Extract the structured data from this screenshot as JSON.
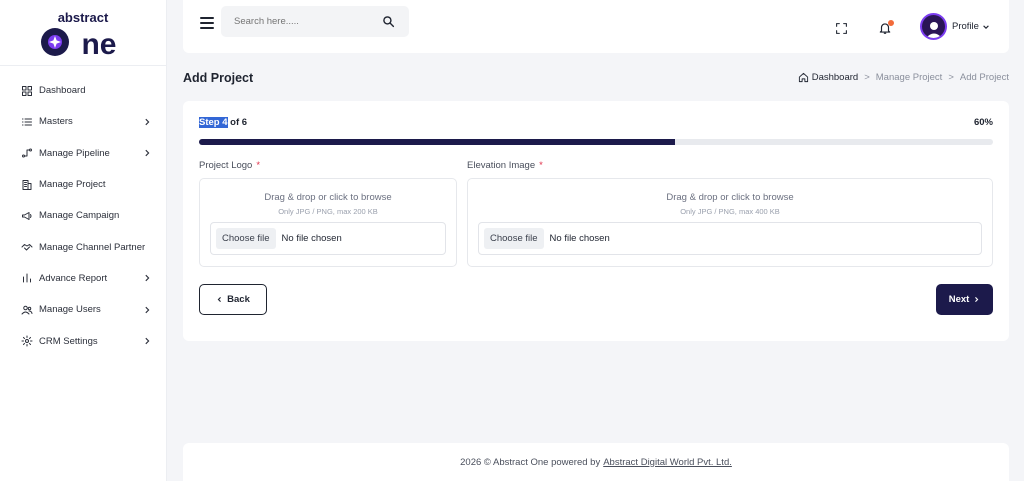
{
  "brand": {
    "logo_top": "abstract",
    "logo_bottom": "one",
    "colors": {
      "primary": "#1c1a4b",
      "accent_purple": "#7b3cf0",
      "notification": "#f26b3a",
      "required": "#e0314b"
    }
  },
  "header": {
    "search_placeholder": "Search here.....",
    "profile_label": "Profile"
  },
  "sidebar": {
    "items": [
      {
        "label": "Dashboard",
        "icon": "grid-icon",
        "has_submenu": false
      },
      {
        "label": "Masters",
        "icon": "list-icon",
        "has_submenu": true
      },
      {
        "label": "Manage Pipeline",
        "icon": "pipeline-icon",
        "has_submenu": true
      },
      {
        "label": "Manage Project",
        "icon": "building-icon",
        "has_submenu": false
      },
      {
        "label": "Manage Campaign",
        "icon": "megaphone-icon",
        "has_submenu": false
      },
      {
        "label": "Manage Channel Partner",
        "icon": "handshake-icon",
        "has_submenu": false
      },
      {
        "label": "Advance Report",
        "icon": "bar-chart-icon",
        "has_submenu": true
      },
      {
        "label": "Manage Users",
        "icon": "users-icon",
        "has_submenu": true
      },
      {
        "label": "CRM Settings",
        "icon": "gear-icon",
        "has_submenu": true
      }
    ]
  },
  "page": {
    "title": "Add Project",
    "breadcrumb": [
      "Dashboard",
      "Manage Project",
      "Add Project"
    ],
    "breadcrumb_sep": ">"
  },
  "wizard": {
    "step_label": "Step 4",
    "step_of": " of 6",
    "percent_text": "60%",
    "progress": 0.6,
    "fields": [
      {
        "label": "Project Logo",
        "required_mark": "*",
        "drop_text": "Drag & drop or click to browse",
        "hint": "Only JPG / PNG, max 200 KB",
        "choose_label": "Choose file",
        "status": "No file chosen"
      },
      {
        "label": "Elevation Image",
        "required_mark": "*",
        "drop_text": "Drag & drop or click to browse",
        "hint": "Only JPG / PNG, max 400 KB",
        "choose_label": "Choose file",
        "status": "No file chosen"
      }
    ],
    "back_label": "Back",
    "next_label": "Next"
  },
  "footer": {
    "text": "2026 © Abstract One powered by",
    "link": "Abstract Digital World Pvt. Ltd."
  }
}
